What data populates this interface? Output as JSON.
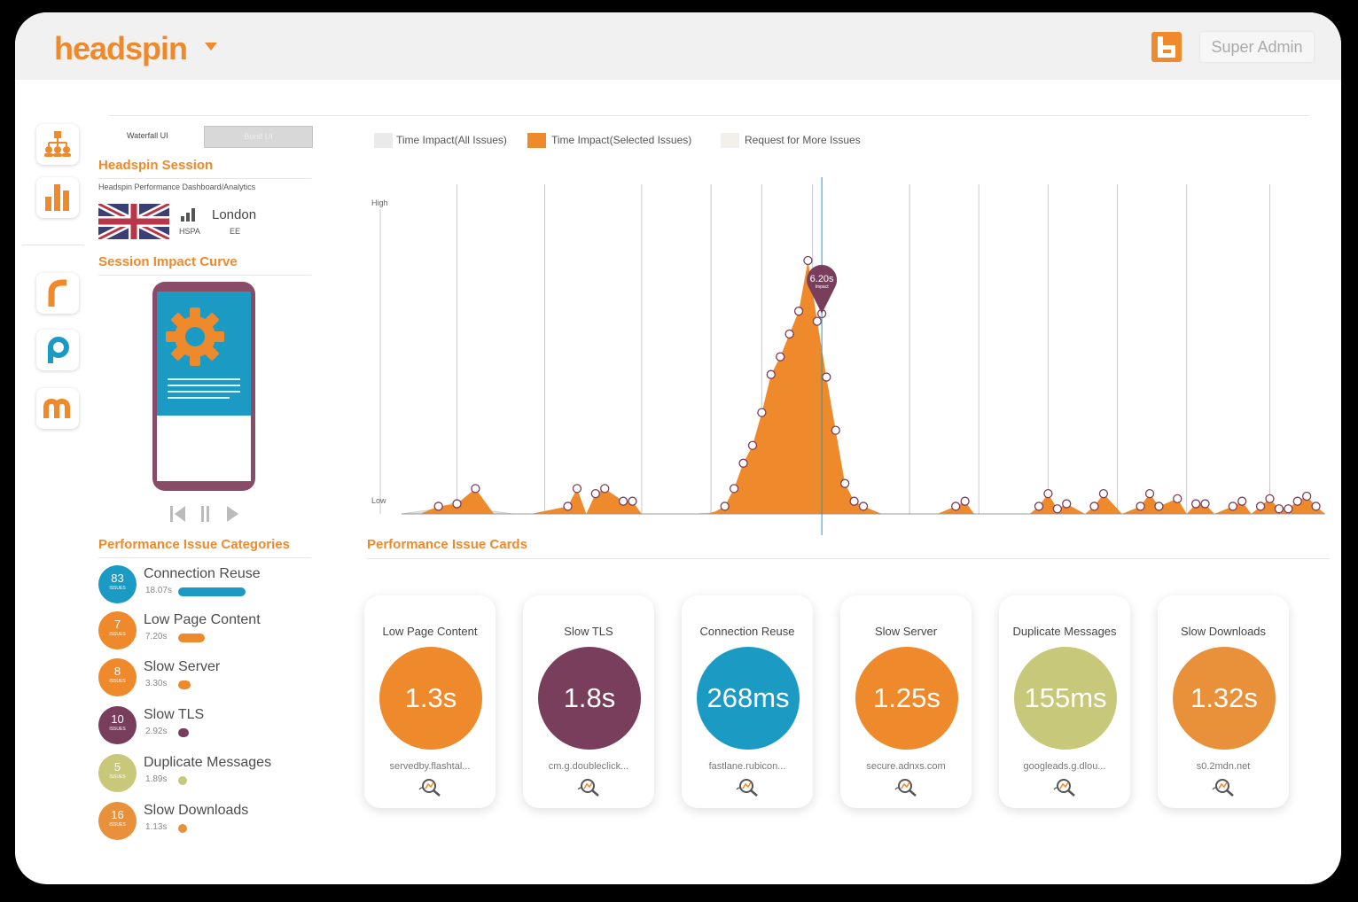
{
  "header": {
    "brand": "headspin",
    "user": "Super Admin"
  },
  "sidebar_rail": {
    "icons": [
      "team-icon",
      "bar-chart-icon",
      "r-app-icon",
      "p-app-icon",
      "m-app-icon"
    ]
  },
  "view_toggle": {
    "waterfall": "Waterfall UI",
    "other": "Burst UI"
  },
  "session": {
    "title": "Headspin Session",
    "subtitle": "Headspin Performance Dashboard/Analytics",
    "network": "HSPA",
    "location": "London",
    "carrier": "EE"
  },
  "impact_curve_title": "Session Impact Curve",
  "categories": {
    "title": "Performance Issue Categories",
    "items": [
      {
        "count": "83",
        "unit": "ISSUES",
        "name": "Connection Reuse",
        "time": "18.07s",
        "color": "#1b9bc4",
        "bar_fraction": 1.0
      },
      {
        "count": "7",
        "unit": "ISSUES",
        "name": "Low Page Content",
        "time": "7.20s",
        "color": "#ee8a2c",
        "bar_fraction": 0.4
      },
      {
        "count": "8",
        "unit": "ISSUES",
        "name": "Slow Server",
        "time": "3.30s",
        "color": "#ee8a2c",
        "bar_fraction": 0.18
      },
      {
        "count": "10",
        "unit": "ISSUES",
        "name": "Slow TLS",
        "time": "2.92s",
        "color": "#7a3e5d",
        "bar_fraction": 0.16
      },
      {
        "count": "5",
        "unit": "ISSUES",
        "name": "Duplicate Messages",
        "time": "1.89s",
        "color": "#c8c87a",
        "bar_fraction": 0.1
      },
      {
        "count": "16",
        "unit": "ISSUES",
        "name": "Slow Downloads",
        "time": "1.13s",
        "color": "#e8913a",
        "bar_fraction": 0.06
      }
    ]
  },
  "chart_legend": {
    "all": "Time Impact(All Issues)",
    "selected": "Time Impact(Selected Issues)",
    "request": "Request for More Issues"
  },
  "chart_data": {
    "type": "area",
    "y_tick_labels": [
      "High",
      "Low"
    ],
    "cursor_marker": {
      "value": "6.20s",
      "label": "Impact"
    },
    "series": [
      {
        "name": "Time Impact(Selected Issues)",
        "color": "#ee8a2c",
        "x": [
          0,
          2,
          4,
          6,
          8,
          10,
          11,
          12,
          14,
          18,
          19,
          20,
          21,
          22,
          24,
          25,
          26,
          33,
          34,
          35,
          36,
          37,
          38,
          39,
          40,
          41,
          42,
          43,
          44,
          45,
          46,
          47,
          48,
          49,
          50,
          52,
          54,
          58,
          60,
          61,
          62,
          68,
          69,
          70,
          71,
          72,
          74,
          75,
          76,
          78,
          80,
          81,
          82,
          84,
          85,
          86,
          87,
          88,
          90,
          91,
          92,
          93,
          94,
          95,
          96,
          97,
          98,
          99,
          100
        ],
        "values": [
          0,
          0,
          0.03,
          0.04,
          0.1,
          0,
          0,
          0,
          0,
          0.03,
          0.1,
          0,
          0.08,
          0.1,
          0.05,
          0.05,
          0,
          0,
          0.01,
          0.03,
          0.1,
          0.2,
          0.27,
          0.4,
          0.55,
          0.62,
          0.71,
          0.8,
          1.0,
          0.76,
          0.54,
          0.33,
          0.12,
          0.05,
          0.03,
          0,
          0,
          0,
          0.03,
          0.05,
          0,
          0,
          0.03,
          0.08,
          0.02,
          0.04,
          0,
          0.03,
          0.08,
          0,
          0.03,
          0.08,
          0.03,
          0.06,
          0,
          0.04,
          0.04,
          0,
          0.03,
          0.05,
          0,
          0.03,
          0.06,
          0.02,
          0.02,
          0.05,
          0.07,
          0.03,
          0
        ]
      },
      {
        "name": "Time Impact(All Issues)",
        "color": "#e1e1e1",
        "x": [
          0,
          4,
          6,
          8,
          10,
          12,
          20,
          22,
          24,
          26,
          32,
          36,
          40,
          44,
          46,
          48,
          50,
          52,
          54,
          60,
          70,
          80,
          90,
          100
        ],
        "values": [
          0,
          0.02,
          0.05,
          0.02,
          0.01,
          0,
          0,
          0.02,
          0.03,
          0,
          0,
          0.01,
          0.03,
          0.04,
          0.06,
          0.03,
          0.01,
          0,
          0,
          0,
          0,
          0,
          0,
          0
        ]
      }
    ],
    "vlines_x": [
      6,
      15.5,
      26,
      33.5,
      39,
      44.5,
      55,
      62.5,
      70,
      77.5,
      85,
      94
    ]
  },
  "issue_cards": {
    "title": "Performance Issue Cards",
    "items": [
      {
        "title": "Low Page Content",
        "value": "1.3s",
        "host": "servedby.flashtal...",
        "color": "#ee8a2c"
      },
      {
        "title": "Slow TLS",
        "value": "1.8s",
        "host": "cm.g.doubleclick...",
        "color": "#7a3e5d"
      },
      {
        "title": "Connection Reuse",
        "value": "268ms",
        "host": "fastlane.rubicon...",
        "color": "#1b9bc4"
      },
      {
        "title": "Slow Server",
        "value": "1.25s",
        "host": "secure.adnxs.com",
        "color": "#ee8a2c"
      },
      {
        "title": "Duplicate Messages",
        "value": "155ms",
        "host": "googleads.g.dlou...",
        "color": "#c8c87a"
      },
      {
        "title": "Slow Downloads",
        "value": "1.32s",
        "host": "s0.2mdn.net",
        "color": "#e8913a"
      }
    ]
  }
}
